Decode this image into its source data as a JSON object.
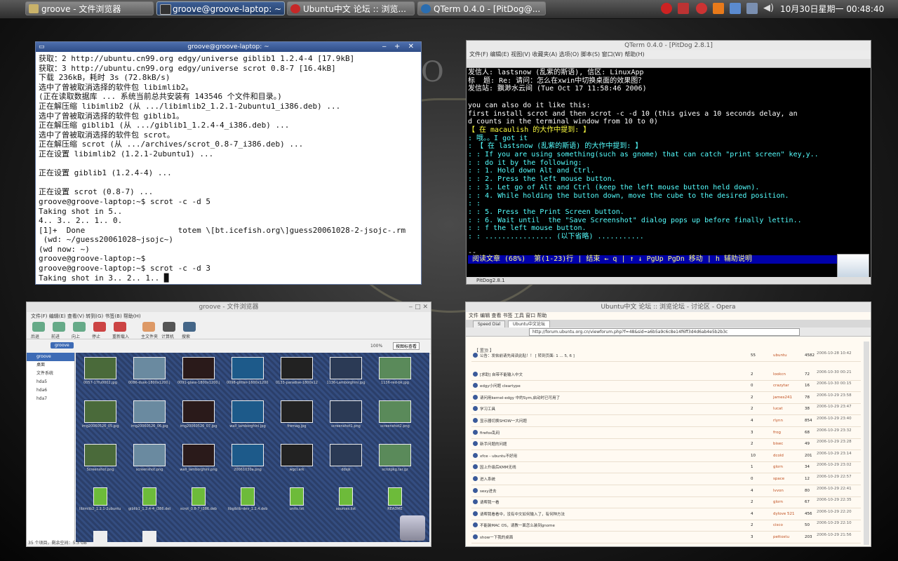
{
  "panel": {
    "tasks": [
      {
        "label": "groove - 文件浏览器",
        "color": "#c9b26a"
      },
      {
        "label": "groove@groove-laptop: ~",
        "color": "#333333"
      },
      {
        "label": "Ubuntu中文 论坛 :: 浏览...",
        "color": "#c62828"
      },
      {
        "label": "QTerm 0.4.0 - [PitDog@...",
        "color": "#2a6db0"
      }
    ],
    "clock": "10月30日星期一  00:48:40"
  },
  "desktop": {
    "bg_letters": "O R"
  },
  "terminal": {
    "title": "groove@groove-laptop: ~",
    "lines": [
      "获取：2 http://ubuntu.cn99.org edgy/universe giblib1 1.2.4-4 [17.9kB]",
      "获取：3 http://ubuntu.cn99.org edgy/universe scrot 0.8-7 [16.4kB]",
      "下载 236kB，耗时 3s (72.8kB/s)",
      "选中了曾被取消选择的软件包 libimlib2。",
      "(正在读取数据库 ... 系统当前总共安装有 143546 个文件和目录。)",
      "正在解压缩 libimlib2 (从 .../libimlib2_1.2.1-2ubuntu1_i386.deb) ...",
      "选中了曾被取消选择的软件包 giblib1。",
      "正在解压缩 giblib1 (从 .../giblib1_1.2.4-4_i386.deb) ...",
      "选中了曾被取消选择的软件包 scrot。",
      "正在解压缩 scrot (从 .../archives/scrot_0.8-7_i386.deb) ...",
      "正在设置 libimlib2 (1.2.1-2ubuntu1) ...",
      "",
      "正在设置 giblib1 (1.2.4-4) ...",
      "",
      "正在设置 scrot (0.8-7) ...",
      "groove@groove-laptop:~$ scrot -c -d 5",
      "Taking shot in 5.. ",
      "4.. 3.. 2.. 1.. 0.",
      "[1]+  Done                    totem \\[bt.icefish.org\\]guess20061028-2-jsojc-.rm",
      " (wd: ~/guess20061028~jsojc~)",
      "(wd now: ~)",
      "groove@groove-laptop:~$",
      "groove@groove-laptop:~$ scrot -c -d 3",
      "Taking shot in 3.. 2.. 1.. █"
    ]
  },
  "qterm": {
    "title": "QTerm 0.4.0 - [PitDog 2.8.1]",
    "menu": "文件(F)  编辑(E)  视图(V)  收藏夹(A)  选项(O)  脚本(S)  窗口(W)  帮助(H)",
    "lines": [
      {
        "text": "发信人: lastsnow (乱紫的斯语), 信区: LinuxApp",
        "cls": ""
      },
      {
        "text": "标  题: Re: 请问：怎么在xwin中切换桌面的效果图？",
        "cls": ""
      },
      {
        "text": "发信站: 飘渺水云间 (Tue Oct 17 11:58:46 2006)",
        "cls": ""
      },
      {
        "text": "",
        "cls": ""
      },
      {
        "text": "you can also do it like this:",
        "cls": ""
      },
      {
        "text": "first install scrot and then scrot -c -d 10 (this gives a 10 seconds delay, an",
        "cls": ""
      },
      {
        "text": "d counts in the terminal window from 10 to 0)",
        "cls": ""
      },
      {
        "text": "【 在 macaulish 的大作中提到: 】",
        "cls": "q-y"
      },
      {
        "text": ": 哦。。I got it",
        "cls": "q-c"
      },
      {
        "text": ": 【 在 lastsnow (乱紫的斯语) 的大作中提到: 】",
        "cls": "q-c"
      },
      {
        "text": ": : If you are using something(such as gnome) that can catch \"print screen\" key,y..",
        "cls": "q-c"
      },
      {
        "text": ": : do it by the following:",
        "cls": "q-c"
      },
      {
        "text": ": : 1. Hold down Alt and Ctrl.",
        "cls": "q-c"
      },
      {
        "text": ": : 2. Press the left mouse button.",
        "cls": "q-c"
      },
      {
        "text": ": : 3. Let go of Alt and Ctrl (keep the left mouse button held down).",
        "cls": "q-c"
      },
      {
        "text": ": : 4. While holding the button down, move the cube to the desired position.",
        "cls": "q-c"
      },
      {
        "text": ": :",
        "cls": "q-c"
      },
      {
        "text": ": : 5. Press the Print Screen button.",
        "cls": "q-c"
      },
      {
        "text": ": : 6. Wait until  the \"Save Screenshot\" dialog pops up before finally lettin..",
        "cls": "q-c"
      },
      {
        "text": ": : f the left mouse button.",
        "cls": "q-c"
      },
      {
        "text": ": : ................ (以下省略) ...........",
        "cls": "q-c"
      },
      {
        "text": "",
        "cls": ""
      },
      {
        "text": "--",
        "cls": ""
      }
    ],
    "status": " 阅读文章 (68%)  第(1-23)行 | 结束 ← q | ↑ ↓ PgUp PgDn 移动 | h 辅助说明",
    "footer": "PitDog2.8.1"
  },
  "files": {
    "title": "groove - 文件浏览器",
    "menu": "文件(F)  编辑(E)  查看(V)  转到(G)  书签(B)  帮助(H)",
    "toolbar": [
      "后退",
      "前进",
      "向上",
      "停止",
      "重新载入",
      "主文件夹",
      "计算机",
      "搜索"
    ],
    "location": "groove",
    "zoom": "100%",
    "view_mode": "按图标查看",
    "sidebar": [
      "groove",
      "桌面",
      "文件系统",
      "hda5",
      "hda6",
      "hda7"
    ],
    "items": [
      "0057-17fu0002.jpg",
      "0086-dusk-1800x1200.jpg",
      "0091-glass-1800x1200.jpg",
      "0098-glitter-1600x1200.jpg",
      "0133-paradise-1800x1200.jpg",
      "1136-Lamborghini.jpg",
      "1136-red-bk.jpg",
      "img20060526_05.jpg",
      "img20060526_06.jpg",
      "img20060526_07.jpg",
      "wall_lamborghini.jpg",
      "fremag.jpg",
      "screenshot1.png",
      "screenshot2.png",
      "Screenshot.png",
      "screenshot.png",
      "wall_lamborghini.png",
      "20061030a.png",
      "wgcl.ark",
      "ddsjk",
      "scrotpkg.tar.gz",
      "libimlib2_1.2.1-2ubuntu1_i386.deb",
      "giblib1_1.2.4-4_i386.deb",
      "scrot_0.8-7_i386.deb",
      "libgiblib-dev_1.2.4.deb",
      "units.txt",
      "sources.list",
      "README",
      "notes.txt",
      "todo.txt"
    ],
    "status": "35 个项目，剩余空间：5.3 GB"
  },
  "opera": {
    "title": "Ubuntu中文 论坛 :: 浏览论坛 - 讨论区 - Opera",
    "menu": "文件  编辑  查看  书签  工具  窗口  帮助",
    "tabs": [
      "Speed Dial",
      "Ubuntu中文论坛"
    ],
    "url": "http://forum.ubuntu.org.cn/viewforum.php?f=48&sid=a6b5a9c6c8e14f6ff3d4d6ab4e5b2b3c",
    "header": "【 置顶 】",
    "topics": [
      {
        "title": "公告：发帖前请先阅读此贴！！ [ 转到页面: 1 ... 5, 6 ]",
        "replies": "55",
        "author": "ubuntu",
        "views": "4582",
        "date": "2006-10-28 10:42"
      },
      {
        "title": "[求助] 自带不能输入中文",
        "replies": "2",
        "author": "lookcn",
        "views": "72",
        "date": "2006-10-30 00:21"
      },
      {
        "title": "edgy小问题 cleartype",
        "replies": "0",
        "author": "crazytar",
        "views": "16",
        "date": "2006-10-30 00:15"
      },
      {
        "title": "请问用kernel-edgy 中的Sym,启动时已可用了",
        "replies": "2",
        "author": "james241",
        "views": "78",
        "date": "2006-10-29 23:58"
      },
      {
        "title": "学习工具",
        "replies": "2",
        "author": "lucat",
        "views": "38",
        "date": "2006-10-29 23:47"
      },
      {
        "title": "显示器切换SHOW一大问题",
        "replies": "4",
        "author": "rlynn",
        "views": "854",
        "date": "2006-10-29 23:40"
      },
      {
        "title": "firefox乱码",
        "replies": "3",
        "author": "frog",
        "views": "68",
        "date": "2006-10-29 23:32"
      },
      {
        "title": "新手问题的问题",
        "replies": "2",
        "author": "bisec",
        "views": "49",
        "date": "2006-10-29 23:28"
      },
      {
        "title": "xfce - ubuntu不好用",
        "replies": "10",
        "author": "dcold",
        "views": "201",
        "date": "2006-10-29 23:14"
      },
      {
        "title": "因上升级后KMM无线",
        "replies": "1",
        "author": "glorn",
        "views": "34",
        "date": "2006-10-29 23:02"
      },
      {
        "title": "进入系统",
        "replies": "0",
        "author": "space",
        "views": "12",
        "date": "2006-10-29 22:57"
      },
      {
        "title": "sexy进去",
        "replies": "4",
        "author": "lvvon",
        "views": "80",
        "date": "2006-10-29 22:41"
      },
      {
        "title": "请帮我一看",
        "replies": "2",
        "author": "glorn",
        "views": "67",
        "date": "2006-10-29 22:35"
      },
      {
        "title": "请帮我看看中，没有中文如何输入了，有何种方法",
        "replies": "4",
        "author": "dylove 521",
        "views": "456",
        "date": "2006-10-29 22:20"
      },
      {
        "title": "不能装MAC OS，请教一面怎么装到gnome",
        "replies": "2",
        "author": "cisco",
        "views": "50",
        "date": "2006-10-29 22:10"
      },
      {
        "title": "show一下我的桌面",
        "replies": "3",
        "author": "pettostu",
        "views": "203",
        "date": "2006-10-29 21:56"
      }
    ]
  }
}
